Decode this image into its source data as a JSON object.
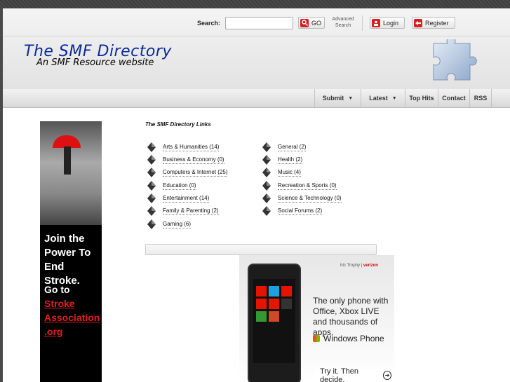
{
  "header": {
    "search": {
      "label": "Search:",
      "value": "",
      "placeholder": ""
    },
    "go_label": "GO",
    "advanced_search": "Advanced Search",
    "login_label": "Login",
    "register_label": "Register"
  },
  "logo": {
    "title": "The SMF Directory",
    "subtitle": "An SMF Resource website"
  },
  "nav": {
    "items": [
      {
        "label": "Submit",
        "has_dropdown": true
      },
      {
        "label": "Latest",
        "has_dropdown": true
      },
      {
        "label": "Top Hits",
        "has_dropdown": false
      },
      {
        "label": "Contact",
        "has_dropdown": false
      },
      {
        "label": "RSS",
        "has_dropdown": false
      }
    ]
  },
  "content": {
    "title": "The SMF Directory Links",
    "categories_left": [
      "Arts & Humanities (14)",
      "Business & Economy (0)",
      "Computers & Internet (25)",
      "Education (0)",
      "Entertainment (14)",
      "Family & Parenting (2)",
      "Gaming (6)"
    ],
    "categories_right": [
      "General (2)",
      "Health (2)",
      "Music (4)",
      "Recreation & Sports (0)",
      "Science & Technology (0)",
      "Social Forums (2)"
    ]
  },
  "ad_left": {
    "headline": "Join the Power To End Stroke.",
    "goto": "Go to",
    "link": "Stroke Association .org"
  },
  "ad_right": {
    "brand": "htc Trophy",
    "carrier": "verizon",
    "tagline": "The only phone with Office, Xbox LIVE and thousands of apps.",
    "product": "Windows Phone",
    "cta": "Try it. Then decide."
  },
  "colors": {
    "logo_blue": "#0a2a9a",
    "accent_red": "#d81e1e",
    "background": "#4a4a4a"
  }
}
